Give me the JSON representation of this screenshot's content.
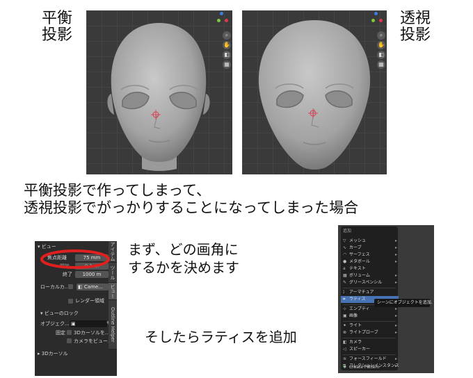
{
  "labels": {
    "ortho": [
      "平衡",
      "投影"
    ],
    "persp": [
      "透視",
      "投影"
    ],
    "main_line1": "平衡投影で作ってしまって、",
    "main_line2": "透視投影でがっかりすることになってしまった場合",
    "step1_line1": "まず、どの画角に",
    "step1_line2": "するかを決めます",
    "step2": "そしたらラティスを追加"
  },
  "viewport": {
    "nav_icons": [
      "zoom-icon",
      "hand-icon",
      "camera-icon",
      "grid-icon"
    ],
    "gizmo_colors": {
      "x": "#e0384a",
      "y": "#7fc93a",
      "z": "#3d7fe0"
    }
  },
  "properties": {
    "section_view": "ビュー",
    "focal_label": "焦点距離",
    "focal_value": "75 mm",
    "clip_start_label": "開始",
    "clip_start_value": "0.1 m",
    "clip_end_label": "終了",
    "clip_end_value": "1000 m",
    "local_camera_label": "ローカルカ...",
    "camera_value": "Came...",
    "render_region_label": "レンダー領域",
    "lock_section": "ビューのロック",
    "object_label": "オブジェク...",
    "lock_label": "固定",
    "lock_cursor": "3Dカーソルを...",
    "lock_camera": "カメラをビュー...",
    "cursor_section": "3Dカーソル",
    "tabs": [
      "アイテム",
      "ツール",
      "ビュー",
      "Outline Helper"
    ],
    "highlight_color": "#e0201e"
  },
  "add_menu": {
    "title": "追加",
    "items": [
      {
        "icon": "▽",
        "label": "メッシュ",
        "sub": true
      },
      {
        "icon": "∿",
        "label": "カーブ",
        "sub": true
      },
      {
        "icon": "◠",
        "label": "サーフェス",
        "sub": true
      },
      {
        "icon": "●",
        "label": "メタボール",
        "sub": true
      },
      {
        "icon": "a",
        "label": "テキスト",
        "sub": false
      },
      {
        "icon": "▦",
        "label": "ボリューム",
        "sub": true
      },
      {
        "icon": "✎",
        "label": "グリースペンシル",
        "sub": true
      },
      {
        "icon": "⟟",
        "label": "アーマチュア",
        "sub": false
      },
      {
        "icon": "⌗",
        "label": "ラティス",
        "sub": false,
        "highlighted": true
      },
      {
        "icon": "⊹",
        "label": "エンプティ",
        "sub": true
      },
      {
        "icon": "▣",
        "label": "画像",
        "sub": true
      },
      {
        "icon": "✦",
        "label": "ライト",
        "sub": true
      },
      {
        "icon": "⊗",
        "label": "ライトプローブ",
        "sub": true
      },
      {
        "icon": "◧",
        "label": "カメラ",
        "sub": false
      },
      {
        "icon": "◁",
        "label": "スピーカー",
        "sub": false
      },
      {
        "icon": "≋",
        "label": "フォースフィールド",
        "sub": true
      },
      {
        "icon": "⧉",
        "label": "コレクションインスタンス",
        "sub": true
      },
      {
        "icon": "❖",
        "label": "Create Pattern",
        "sub": false
      }
    ],
    "tooltip": "シーンにオブジェクトを追加.",
    "highlight_color": "#4772b3"
  }
}
